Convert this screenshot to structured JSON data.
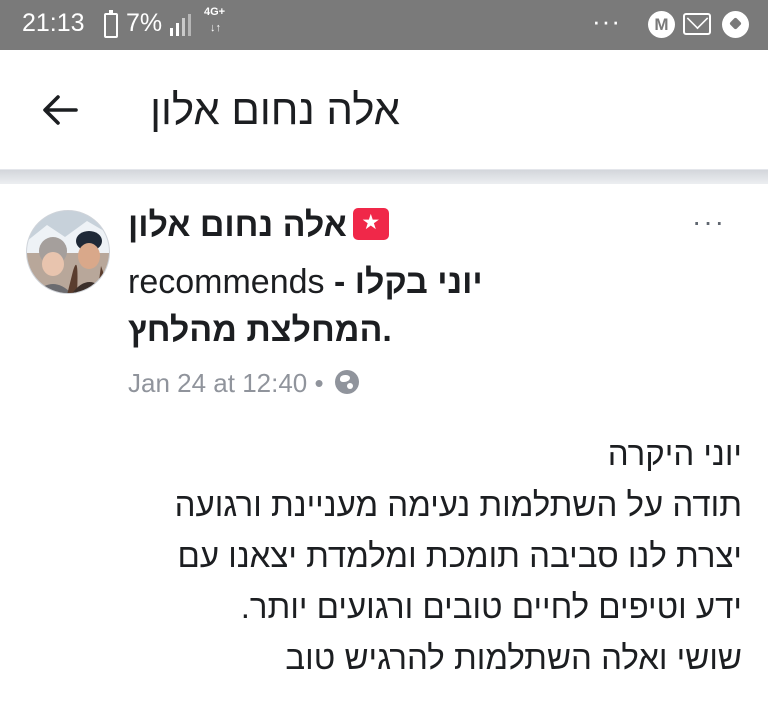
{
  "status_bar": {
    "time": "21:13",
    "battery": "7%",
    "network": "4G+",
    "network_arrows": "↓↑",
    "dots": "···",
    "m_badge": "M"
  },
  "header": {
    "title": "אלה נחום אלון"
  },
  "post": {
    "author": "אלה נחום אלון",
    "recommends_word": "recommends",
    "dash": "-",
    "page_name": "יוני בקלו",
    "page_subtitle": "המחלצת מהלחץ.",
    "timestamp": "Jan 24 at 12:40",
    "separator": "•",
    "more": "···",
    "body_lines": [
      "יוני היקרה",
      "תודה על השתלמות נעימה מעניינת ורגועה",
      "יצרת לנו סביבה תומכת ומלמדת יצאנו עם",
      "ידע וטיפים לחיים טובים ורגועים יותר.",
      "שושי ואלה השתלמות להרגיש טוב"
    ]
  },
  "colors": {
    "status_bar": "#7a7a7a",
    "badge": "#f02849",
    "meta_text": "#90949c"
  },
  "icons": [
    "back-arrow-icon",
    "recommend-star-icon",
    "globe-icon",
    "more-options-icon",
    "battery-icon",
    "signal-icon",
    "mail-icon",
    "soccer-ball-icon"
  ]
}
